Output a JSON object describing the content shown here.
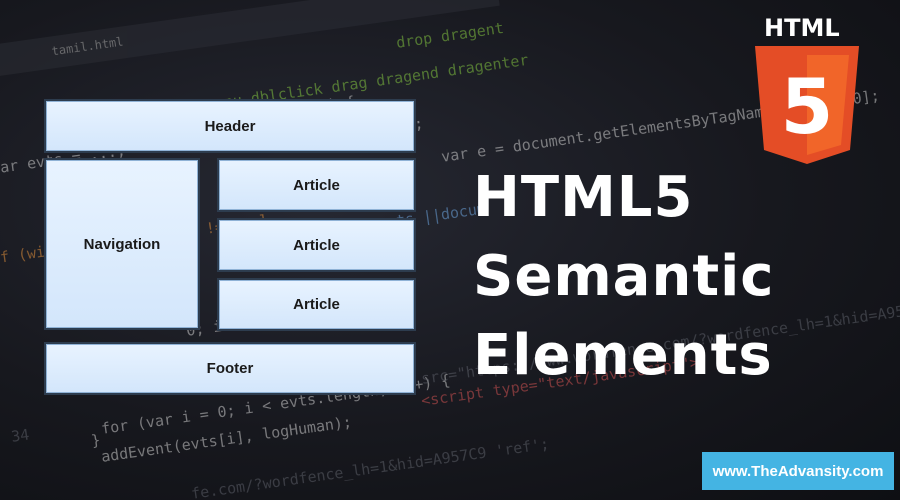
{
  "brand": {
    "html_word": "HTML",
    "logo_digit": "5"
  },
  "layout_diagram": {
    "header": "Header",
    "navigation": "Navigation",
    "articles": [
      "Article",
      "Article",
      "Article"
    ],
    "footer": "Footer"
  },
  "title": {
    "line1": "HTML5",
    "line2": "Semantic",
    "line3": "Elements"
  },
  "website": "www.TheAdvansity.com",
  "colors": {
    "background": "#15161b",
    "box_fill": "#dbeafc",
    "box_border": "#2d3c4e",
    "html5_orange": "#e44d26",
    "html5_orange_light": "#f16529",
    "badge": "#44b4e3"
  },
  "background_code": {
    "tab": "tamil.html",
    "lines": [
      {
        "text": "drop dragent",
        "cls": "c-green"
      },
      {
        "text": "menu dblclick drag dragend dragenter",
        "cls": "c-green"
      },
      {
        "text": "( 0) {",
        "cls": "c-white"
      },
      {
        "text": "});",
        "cls": "c-white"
      },
      {
        "text": "var e = document.getElementsByTagName('body')[0];",
        "cls": "c-white"
      },
      {
        "text": "var evts = ...;",
        "cls": "c-white"
      },
      {
        "text": "ts ||docum",
        "cls": "c-blue"
      },
      {
        "text": "if (window.top.location !== url",
        "cls": "c-orange"
      },
      {
        "text": "0; i < e",
        "cls": "c-white"
      },
      {
        "text": "for (var i = 0; i < evts.length; i++) {",
        "cls": "c-white"
      },
      {
        "text": "addEvent(evts[i], logHuman);",
        "cls": "c-white"
      },
      {
        "text": "<script type=\"text/javascript\">",
        "cls": "c-red"
      },
      {
        "text": "src=\"https://www.wordfence.com/?wordfence_lh=1&hid=A957C9",
        "cls": "c-dim"
      },
      {
        "text": "fe.com/?wordfence_lh=1&hid=A957C9 'ref';",
        "cls": "c-dim"
      },
      {
        "text": "}",
        "cls": "c-white"
      },
      {
        "text": "34",
        "cls": "c-dim"
      }
    ]
  }
}
